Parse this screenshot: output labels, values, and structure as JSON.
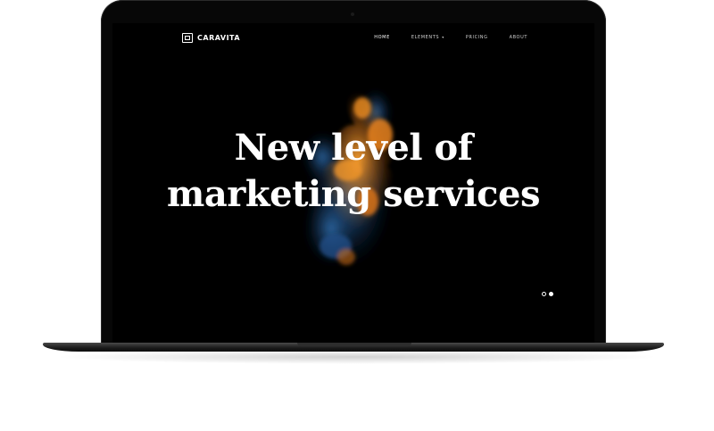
{
  "brand": {
    "name": "CARAVITA",
    "icon": "caravita-logo-icon"
  },
  "nav": {
    "items": [
      {
        "label": "HOME",
        "active": true
      },
      {
        "label": "ELEMENTS",
        "has_dropdown": true,
        "dropdown_icon": "chevron-down-icon"
      },
      {
        "label": "PRICING"
      },
      {
        "label": "ABOUT"
      }
    ]
  },
  "hero": {
    "title_line1": "New level of",
    "title_line2": "marketing services"
  },
  "slider": {
    "total_slides": 2,
    "active_slide": 2
  },
  "colors": {
    "screen_background": "#000000",
    "ink_orange": "#e8821e",
    "ink_blue": "#1f4f8a",
    "text": "#ffffff"
  }
}
